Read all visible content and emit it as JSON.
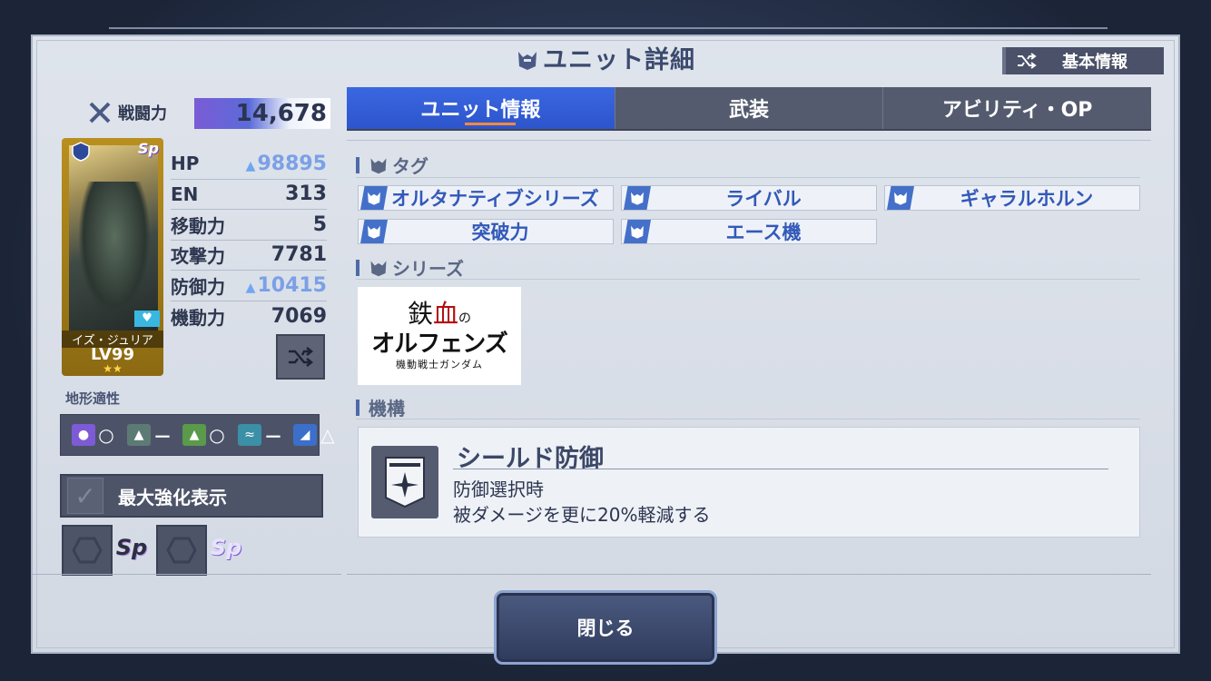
{
  "header": {
    "title": "ユニット詳細",
    "basic_info_button": "基本情報"
  },
  "power": {
    "label": "戦闘力",
    "value": "14,678"
  },
  "unit_card": {
    "pilot_name": "イズ・ジュリア",
    "level": "LV99",
    "stars": "★★",
    "sp_badge": "Sp"
  },
  "stats": [
    {
      "label": "HP",
      "value": "98895",
      "boosted": true
    },
    {
      "label": "EN",
      "value": "313",
      "boosted": false
    },
    {
      "label": "移動力",
      "value": "5",
      "boosted": false
    },
    {
      "label": "攻撃力",
      "value": "7781",
      "boosted": false
    },
    {
      "label": "防御力",
      "value": "10415",
      "boosted": true
    },
    {
      "label": "機動力",
      "value": "7069",
      "boosted": false
    }
  ],
  "terrain": {
    "label": "地形適性",
    "items": [
      {
        "icon": "space-icon",
        "grade": "○"
      },
      {
        "icon": "land-icon",
        "grade": "－"
      },
      {
        "icon": "mountain-icon",
        "grade": "○"
      },
      {
        "icon": "water-icon",
        "grade": "－"
      },
      {
        "icon": "underground-icon",
        "grade": "△"
      }
    ]
  },
  "max_enhance_label": "最大強化表示",
  "tabs": [
    {
      "label": "ユニット情報",
      "active": true
    },
    {
      "label": "武装",
      "active": false
    },
    {
      "label": "アビリティ・OP",
      "active": false
    }
  ],
  "sections": {
    "tag_label": "タグ",
    "series_label": "シリーズ",
    "mechanism_label": "機構"
  },
  "tags": [
    "オルタナティブシリーズ",
    "ライバル",
    "ギャラルホルン",
    "突破力",
    "エース機"
  ],
  "series_logo": {
    "line1a": "鉄",
    "line1b": "血",
    "line1c": "の",
    "line2": "オルフェンズ",
    "line3": "機動戦士ガンダム"
  },
  "ability": {
    "name": "シールド防御",
    "desc1": "防御選択時",
    "desc2": "被ダメージを更に20%軽減する"
  },
  "close_button": "閉じる",
  "colors": {
    "accent_blue": "#2d55cc",
    "tab_underline": "#ff8a3c",
    "tag_text": "#3359b8",
    "boost_value": "#7ba0e6"
  }
}
